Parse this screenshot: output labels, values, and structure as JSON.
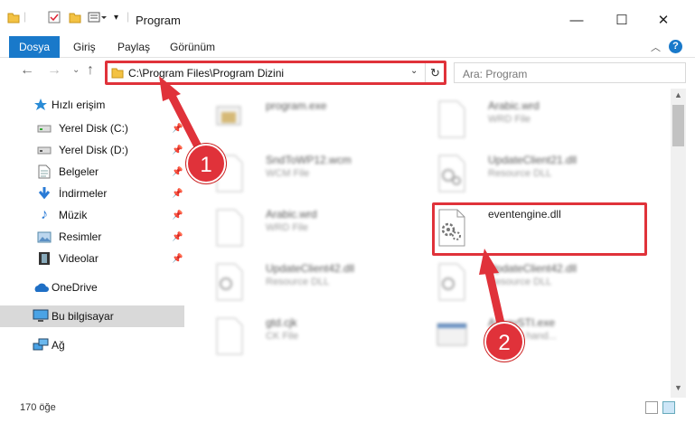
{
  "window": {
    "title": "Program"
  },
  "ribbon": {
    "tabs": [
      "Dosya",
      "Giriş",
      "Paylaş",
      "Görünüm"
    ],
    "help": "?"
  },
  "address": {
    "path": "C:\\Program Files\\Program Dizini"
  },
  "search": {
    "placeholder": "Ara: Program"
  },
  "sidebar": {
    "quick_access": "Hızlı erişim",
    "items": [
      "Yerel Disk (C:)",
      "Yerel Disk (D:)",
      "Belgeler",
      "İndirmeler",
      "Müzik",
      "Resimler",
      "Videolar"
    ],
    "onedrive": "OneDrive",
    "this_pc": "Bu bilgisayar",
    "network": "Ağ"
  },
  "files": [
    {
      "name": "program.exe",
      "type": ""
    },
    {
      "name": "Arabic.wrd",
      "type": "WRD File"
    },
    {
      "name": "SndToWP12.wcm",
      "type": "WCM File"
    },
    {
      "name": "UpdateClient21.dll",
      "type": "Resource DLL"
    },
    {
      "name": "Arabic.wrd",
      "type": "WRD File"
    },
    {
      "name": "eventengine.dll",
      "type": ""
    },
    {
      "name": "UpdateClient42.dll",
      "type": "Resource DLL"
    },
    {
      "name": "UpdateClient42.dll",
      "type": "Resource DLL"
    },
    {
      "name": "gtd.cjk",
      "type": "CK File"
    },
    {
      "name": "AssaySTI.exe",
      "type": "... event hand..."
    }
  ],
  "status": {
    "item_count": "170 öğe"
  },
  "annotations": {
    "badge1": "1",
    "badge2": "2",
    "color": "#e0323a"
  },
  "colors": {
    "accent": "#1979ca",
    "selected": "#d9d9d9"
  }
}
